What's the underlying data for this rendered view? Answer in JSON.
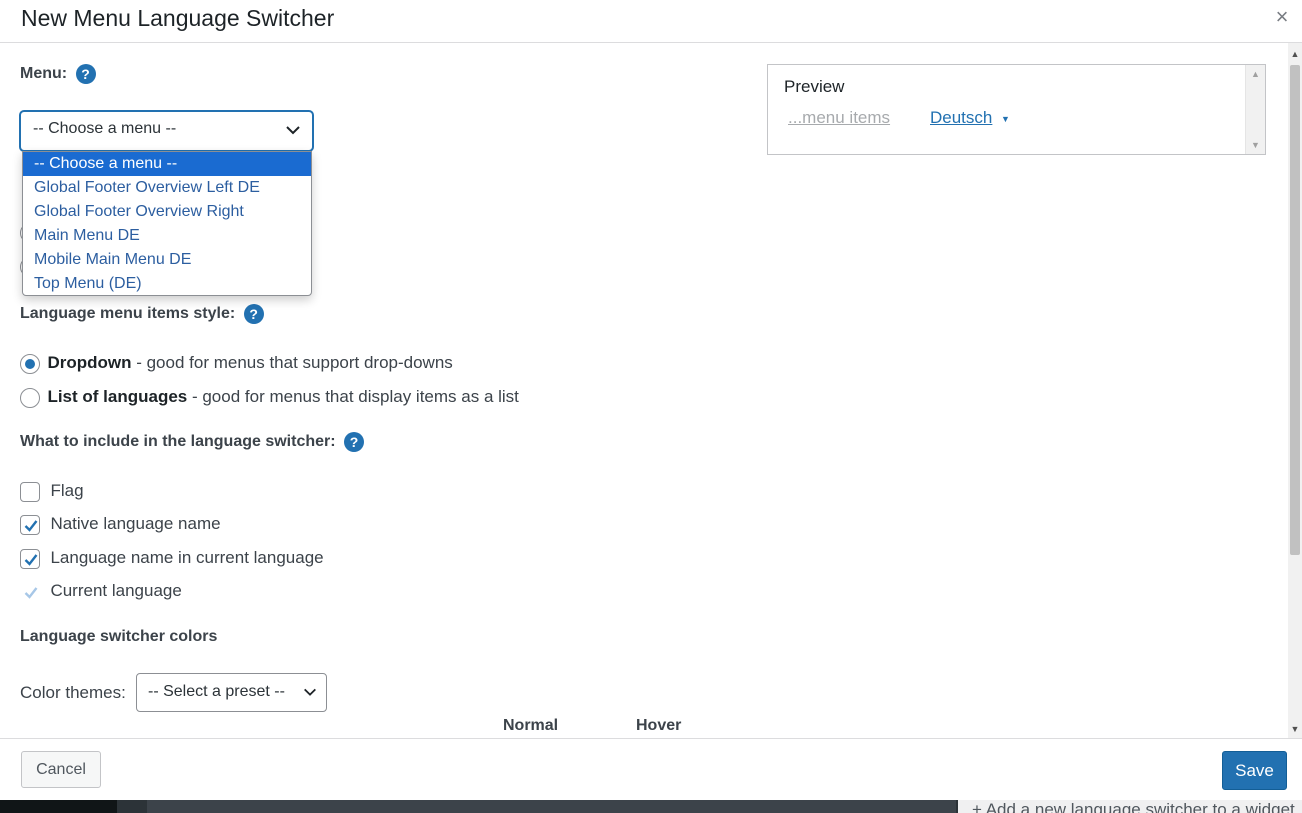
{
  "dialog": {
    "title": "New Menu Language Switcher",
    "close_symbol": "×"
  },
  "menu_field": {
    "label": "Menu:",
    "help": "?",
    "selected": "-- Choose a menu --",
    "options": [
      "-- Choose a menu --",
      "Global Footer Overview Left DE",
      "Global Footer Overview Right",
      "Main Menu DE",
      "Mobile Main Menu DE",
      "Top Menu (DE)"
    ]
  },
  "style_section": {
    "label": "Language menu items style:",
    "help": "?",
    "options": [
      {
        "name": "Dropdown",
        "desc": " - good for menus that support drop-downs",
        "checked": true
      },
      {
        "name": "List of languages",
        "desc": " - good for menus that display items as a list",
        "checked": false
      }
    ]
  },
  "include_section": {
    "label": "What to include in the language switcher:",
    "help": "?",
    "items": [
      {
        "label": "Flag",
        "checked": false,
        "disabled": false
      },
      {
        "label": "Native language name",
        "checked": true,
        "disabled": false
      },
      {
        "label": "Language name in current language",
        "checked": true,
        "disabled": false
      },
      {
        "label": "Current language",
        "checked": true,
        "disabled": true
      }
    ]
  },
  "colors_section": {
    "label": "Language switcher colors",
    "themes_label": "Color themes:",
    "preset_selected": "-- Select a preset --",
    "col_normal": "Normal",
    "col_hover": "Hover"
  },
  "preview": {
    "title": "Preview",
    "items_text": "...menu items",
    "language": "Deutsch"
  },
  "footer": {
    "cancel": "Cancel",
    "save": "Save"
  },
  "background": {
    "behind_text": "+ Add a new language switcher to a widget"
  },
  "colors": {
    "accent": "#2271b1",
    "dropdown_highlight": "#1a6bd1"
  }
}
